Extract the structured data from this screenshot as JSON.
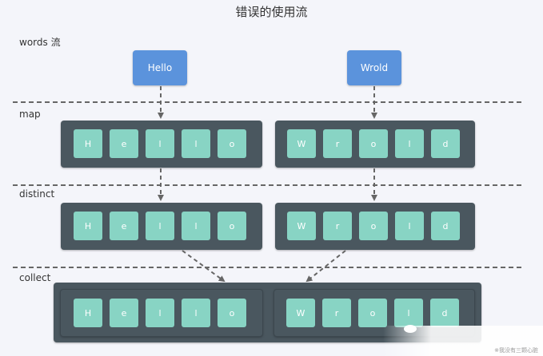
{
  "title": "错误的使用流",
  "stages": {
    "words": "words 流",
    "map": "map",
    "distinct": "distinct",
    "collect": "collect"
  },
  "words": [
    "Hello",
    "Wrold"
  ],
  "rows": {
    "map": [
      [
        "H",
        "e",
        "l",
        "l",
        "o"
      ],
      [
        "W",
        "r",
        "o",
        "l",
        "d"
      ]
    ],
    "distinct": [
      [
        "H",
        "e",
        "l",
        "l",
        "o"
      ],
      [
        "W",
        "r",
        "o",
        "l",
        "d"
      ]
    ],
    "collect": [
      [
        "H",
        "e",
        "l",
        "l",
        "o"
      ],
      [
        "W",
        "r",
        "o",
        "l",
        "d"
      ]
    ]
  },
  "watermark": "※我没有三颗心脏",
  "colors": {
    "word_box": "#5b93dc",
    "container": "#4a575f",
    "cell": "#88d4c4",
    "arrow": "#666666"
  }
}
